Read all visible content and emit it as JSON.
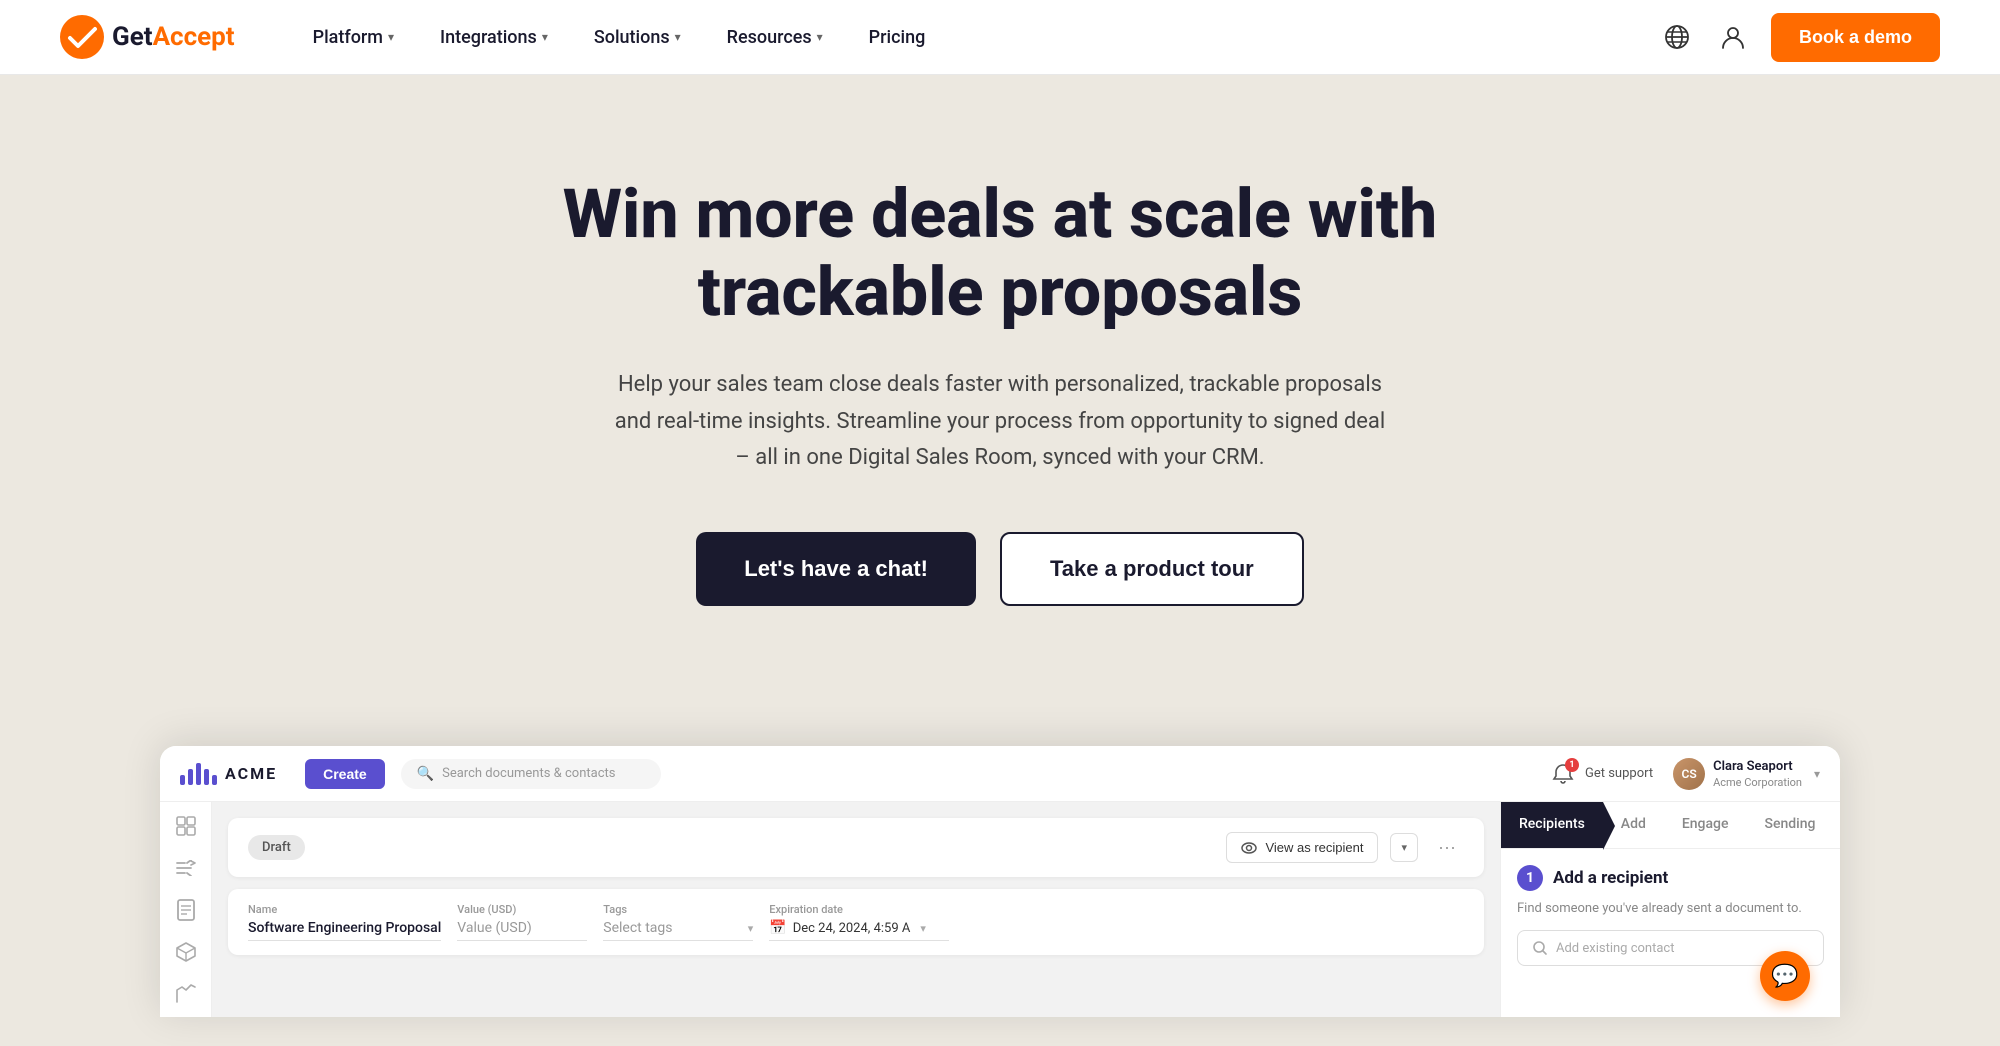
{
  "nav": {
    "logo_text_get": "Get",
    "logo_text_accept": "Accept",
    "items": [
      {
        "label": "Platform",
        "has_chevron": true
      },
      {
        "label": "Integrations",
        "has_chevron": true
      },
      {
        "label": "Solutions",
        "has_chevron": true
      },
      {
        "label": "Resources",
        "has_chevron": true
      },
      {
        "label": "Pricing",
        "has_chevron": false
      }
    ],
    "book_demo": "Book a demo"
  },
  "hero": {
    "title_line1": "Win more deals at scale with",
    "title_line2": "trackable proposals",
    "subtitle": "Help your sales team close deals faster with personalized, trackable proposals and real-time insights. Streamline your process from opportunity to signed deal – all in one Digital Sales Room, synced with your CRM.",
    "btn_chat": "Let's have a chat!",
    "btn_tour": "Take a product tour"
  },
  "app": {
    "acme_label": "ACME",
    "create_btn": "Create",
    "search_placeholder": "Search documents & contacts",
    "get_support": "Get support",
    "support_badge": "1",
    "user_name": "Clara Seaport",
    "user_company": "Acme Corporation",
    "doc": {
      "draft_label": "Draft",
      "view_recipient": "View as recipient",
      "name_label": "Name",
      "name_value": "Software Engineering Proposal",
      "value_label": "Value (USD)",
      "value_placeholder": "Value (USD)",
      "tags_label": "Tags",
      "tags_placeholder": "Select tags",
      "expiry_label": "Expiration date",
      "expiry_value": "Dec 24, 2024, 4:59 A"
    },
    "right_panel": {
      "tabs": [
        {
          "label": "Recipients",
          "active": true
        },
        {
          "label": "Add"
        },
        {
          "label": "Engage"
        },
        {
          "label": "Sending"
        }
      ],
      "step": "1",
      "add_title": "Add a recipient",
      "add_desc": "Find someone you've already sent a document to.",
      "add_search_placeholder": "Add existing contact"
    }
  },
  "colors": {
    "orange": "#ff6b00",
    "dark_navy": "#1a1a2e",
    "purple": "#5a4fcf",
    "bg": "#ece8e0"
  }
}
